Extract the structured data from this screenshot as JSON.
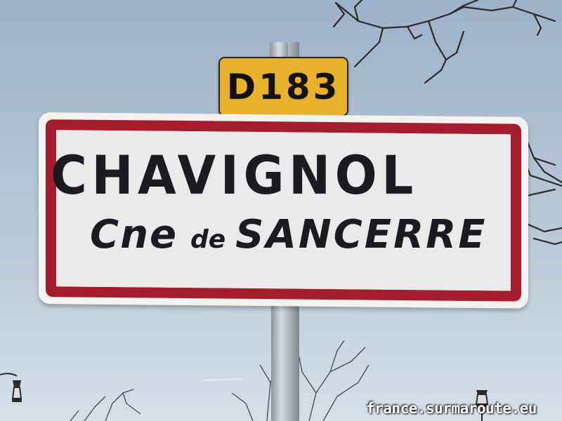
{
  "road_sign": {
    "number": "D183",
    "background_color": "#e8b12b"
  },
  "town_sign": {
    "name": "CHAVIGNOL",
    "commune_prefix": "Cne",
    "commune_connector": "de",
    "commune_name": "SANCERRE",
    "border_color": "#a51c2c",
    "text_color": "#1b1c22"
  },
  "watermark": {
    "text": "france.surmaroute.eu"
  },
  "sky": {
    "top_color": "#9db1c8",
    "bottom_color": "#d6dee6"
  }
}
